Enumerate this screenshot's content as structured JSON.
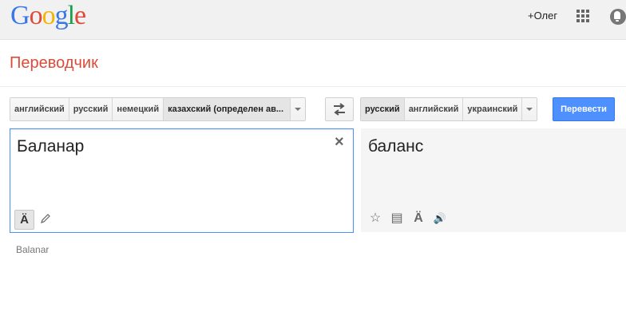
{
  "header": {
    "logo_letters": [
      "G",
      "o",
      "o",
      "g",
      "l",
      "e"
    ],
    "logo_colors": [
      "#3b78e7",
      "#dd4b39",
      "#f5b400",
      "#3b78e7",
      "#1a9e4a",
      "#dd4b39"
    ],
    "user_link": "+Олег",
    "apps_icon": "apps-grid-icon",
    "notifications_icon": "bell-icon"
  },
  "page": {
    "title": "Переводчик"
  },
  "source_langs": {
    "items": [
      "английский",
      "русский",
      "немецкий",
      "казахский (определен ав..."
    ],
    "selected_index": 3
  },
  "target_langs": {
    "items": [
      "русский",
      "английский",
      "украинский"
    ],
    "selected_index": 0
  },
  "swap_icon": "swap-arrows-icon",
  "translate_button": "Перевести",
  "source": {
    "text": "Баланар",
    "clear_glyph": "×",
    "keyboard_glyph": "Ä"
  },
  "target": {
    "text": "баланс",
    "icons": [
      "star-icon",
      "phrasebook-icon",
      "keyboard-icon",
      "speaker-icon"
    ],
    "glyphs": [
      "☆",
      "▤",
      "Ä",
      "🔊"
    ]
  },
  "transliteration": "Balanar"
}
